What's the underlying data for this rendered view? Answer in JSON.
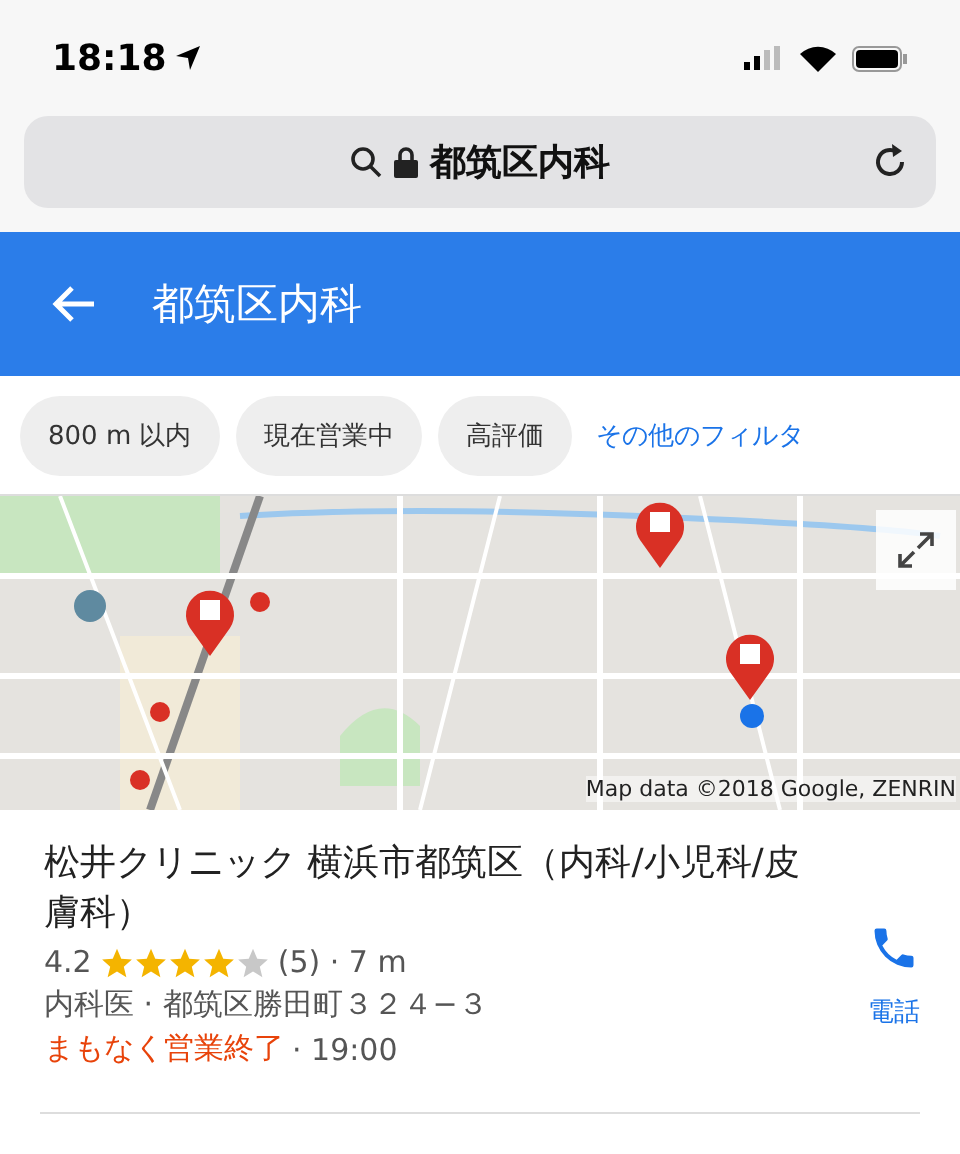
{
  "status_bar": {
    "time": "18:18"
  },
  "address_bar": {
    "text": "都筑区内科"
  },
  "header": {
    "title": "都筑区内科"
  },
  "filters": [
    {
      "label": "800 m 以内",
      "kind": "chip"
    },
    {
      "label": "現在営業中",
      "kind": "chip"
    },
    {
      "label": "高評価",
      "kind": "chip"
    },
    {
      "label": "その他のフィルタ",
      "kind": "link"
    }
  ],
  "map": {
    "kind": "picture",
    "attribution": "Map data ©2018 Google, ZENRIN"
  },
  "result": {
    "name": "松井クリニック 横浜市都筑区（内科/小児科/皮膚科）",
    "rating": "4.2",
    "stars": 4,
    "reviews": "(5) · 7 m",
    "address": "内科医 · 都筑区勝田町３２４−３",
    "hours_status": "まもなく営業終了",
    "hours": " · 19:00",
    "call_label": "電話"
  }
}
